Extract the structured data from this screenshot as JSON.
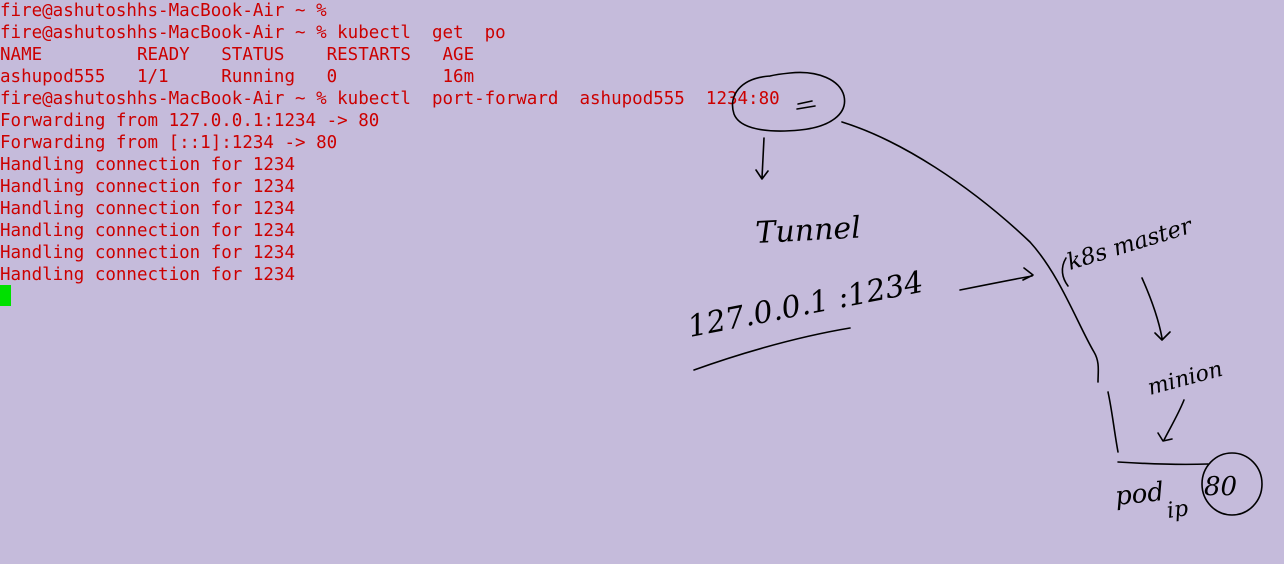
{
  "terminal": {
    "lines": [
      "fire@ashutoshhs-MacBook-Air ~ %",
      "fire@ashutoshhs-MacBook-Air ~ % kubectl  get  po",
      "NAME         READY   STATUS    RESTARTS   AGE",
      "ashupod555   1/1     Running   0          16m",
      "fire@ashutoshhs-MacBook-Air ~ % kubectl  port-forward  ashupod555  1234:80",
      "Forwarding from 127.0.0.1:1234 -> 80",
      "Forwarding from [::1]:1234 -> 80",
      "Handling connection for 1234",
      "Handling connection for 1234",
      "Handling connection for 1234",
      "Handling connection for 1234",
      "Handling connection for 1234",
      "Handling connection for 1234"
    ],
    "text_color": "#cc0000",
    "background_color": "#c5bbdb",
    "cursor_color": "#00e000"
  },
  "annotations": {
    "tunnel": "Tunnel",
    "local_address": "127.0.0.1 :1234",
    "master": "k8s master",
    "minion": "minion",
    "pod": "pod",
    "ip": "ip",
    "port": "80"
  }
}
